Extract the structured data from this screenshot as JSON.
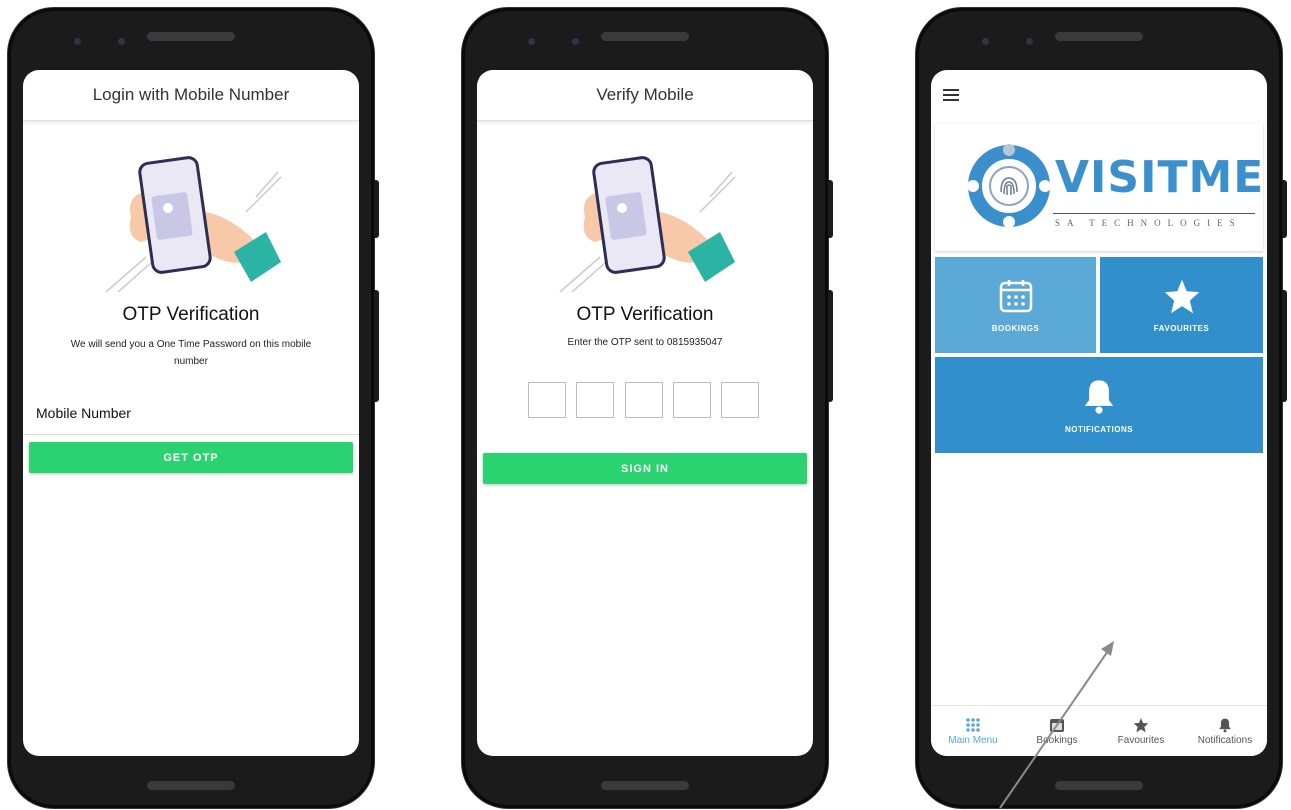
{
  "phone1": {
    "title": "Login with Mobile Number",
    "heading": "OTP Verification",
    "description": "We will send you a One Time Password on this mobile number",
    "field_label": "Mobile Number",
    "button": "GET OTP"
  },
  "phone2": {
    "title": "Verify Mobile",
    "heading": "OTP Verification",
    "description": "Enter the OTP sent to 0815935047",
    "otp_boxes": [
      "",
      "",
      "",
      "",
      ""
    ],
    "button": "SIGN IN"
  },
  "phone3": {
    "logo_text": "VISITME",
    "logo_subtitle": "SA TECHNOLOGIES",
    "tiles": {
      "bookings": "BOOKINGS",
      "favourites": "FAVOURITES",
      "notifications": "NOTIFICATIONS"
    },
    "nav": [
      {
        "label": "Main Menu",
        "icon": "grid-icon",
        "active": true
      },
      {
        "label": "Bookings",
        "icon": "calendar-icon",
        "active": false
      },
      {
        "label": "Favourites",
        "icon": "star-icon",
        "active": false
      },
      {
        "label": "Notifications",
        "icon": "bell-icon",
        "active": false
      }
    ]
  },
  "colors": {
    "green": "#2ad36f",
    "tile_light": "#5aa9d6",
    "tile_dark": "#3190cc",
    "active_nav": "#5aa9d6"
  }
}
